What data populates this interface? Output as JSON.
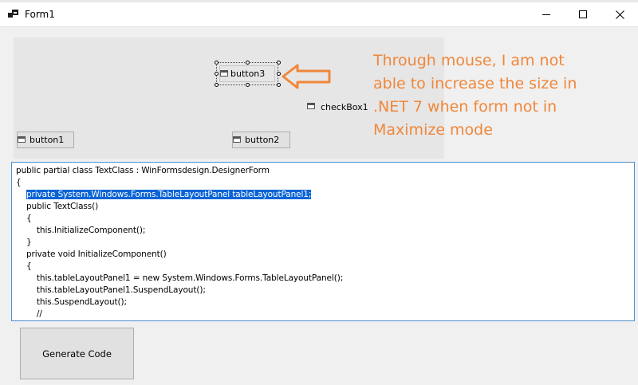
{
  "window": {
    "title": "Form1",
    "icon": "form-icon",
    "controls": {
      "minimize": "minimize-icon",
      "maximize": "maximize-icon",
      "close": "close-icon"
    }
  },
  "designer": {
    "button3": "button3",
    "checkbox1": "checkBox1",
    "button1": "button1",
    "button2": "button2"
  },
  "annotation": {
    "lines": [
      "Through mouse, I am not",
      "able to increase the size in",
      ".NET 7 when form not in",
      "Maximize mode"
    ],
    "color": "#f0873a"
  },
  "code": {
    "lines": [
      "public partial class TextClass : WinFormsdesign.DesignerForm",
      "{",
      "    private System.Windows.Forms.TableLayoutPanel tableLayoutPanel1;",
      "    public TextClass()",
      "    {",
      "        this.InitializeComponent();",
      "    }",
      "    private void InitializeComponent()",
      "    {",
      "        this.tableLayoutPanel1 = new System.Windows.Forms.TableLayoutPanel();",
      "        this.tableLayoutPanel1.SuspendLayout();",
      "        this.SuspendLayout();",
      "        //"
    ],
    "selected_line": 2,
    "selection_color": "#0a64d6"
  },
  "generate_button": {
    "label": "Generate Code"
  }
}
